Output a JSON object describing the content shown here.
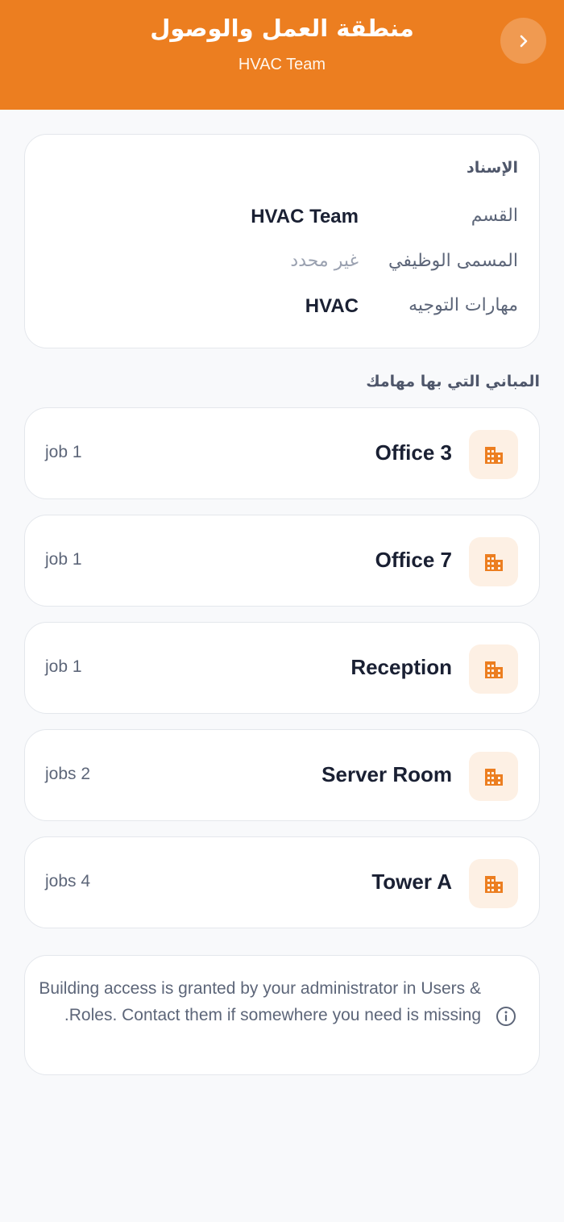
{
  "header": {
    "title": "منطقة العمل والوصول",
    "subtitle": "HVAC Team",
    "back_icon": "chevron-right-icon",
    "color": "#ec7e20"
  },
  "assignment": {
    "title": "الإسناد",
    "rows": [
      {
        "label": "القسم",
        "value": "HVAC Team"
      },
      {
        "label": "المسمى الوظيفي",
        "value": "غير محدد"
      },
      {
        "label": "مهارات التوجيه",
        "value": "HVAC"
      }
    ]
  },
  "buildings": {
    "heading": "المباني التي بها مهامك",
    "icon": "building-icon",
    "items": [
      {
        "name": "Office 3",
        "count": "1 job"
      },
      {
        "name": "Office 7",
        "count": "1 job"
      },
      {
        "name": "Reception",
        "count": "1 job"
      },
      {
        "name": "Server Room",
        "count": "2 jobs"
      },
      {
        "name": "Tower A",
        "count": "4 jobs"
      }
    ]
  },
  "info": {
    "icon": "info-icon",
    "text": "Building access is granted by your administrator in Users & Roles. Contact them if somewhere you need is missing."
  }
}
